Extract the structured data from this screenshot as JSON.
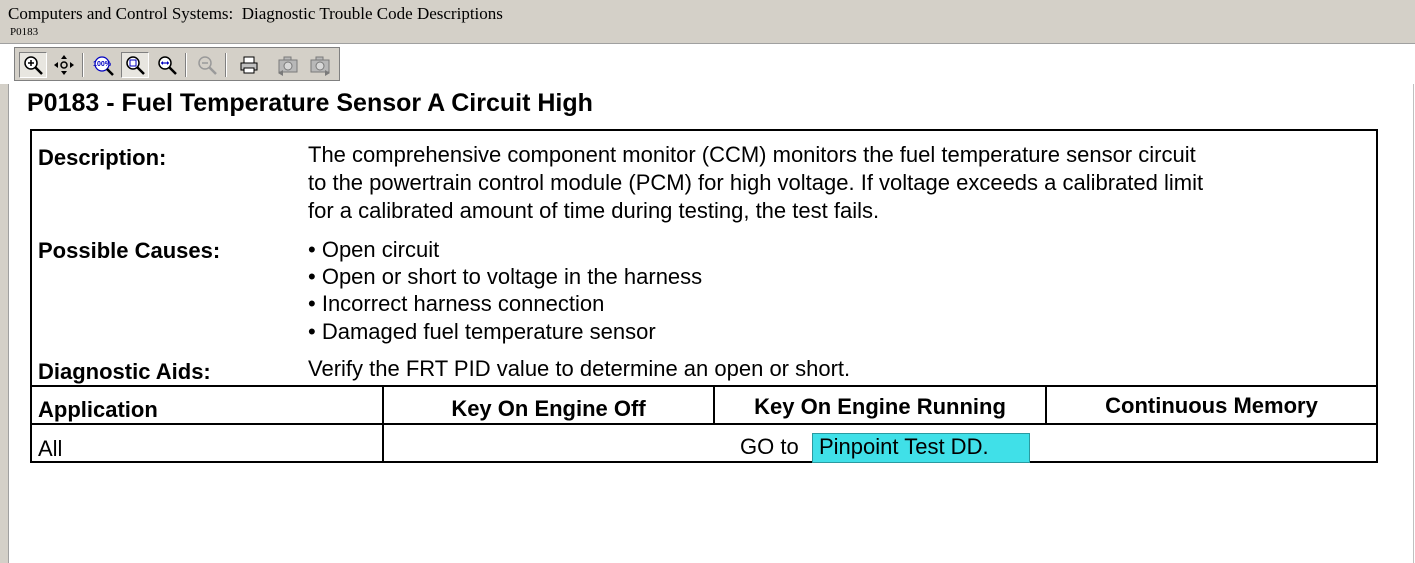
{
  "window": {
    "title": "Computers and Control Systems:  Diagnostic Trouble Code Descriptions",
    "subtitle": "P0183"
  },
  "toolbar": {
    "buttons": [
      {
        "icon": "zoom-in-icon"
      },
      {
        "icon": "pan-icon"
      },
      {
        "icon": "zoom-100-icon",
        "label": "100%"
      },
      {
        "icon": "zoom-fit-icon"
      },
      {
        "icon": "zoom-width-icon"
      },
      {
        "icon": "zoom-out-icon"
      },
      {
        "icon": "print-icon"
      },
      {
        "icon": "camera-back-icon"
      },
      {
        "icon": "camera-forward-icon"
      }
    ]
  },
  "doc": {
    "heading": "P0183 - Fuel Temperature Sensor A Circuit High",
    "description_label": "Description:",
    "description_lines": [
      "The comprehensive component monitor (CCM) monitors the fuel temperature sensor circuit",
      "to the powertrain control module (PCM) for high voltage. If voltage exceeds a calibrated limit",
      "for a calibrated amount of time during testing, the test fails."
    ],
    "causes_label": "Possible Causes:",
    "causes": [
      "Open circuit",
      "Open or short to voltage in the harness",
      "Incorrect harness connection",
      "Damaged fuel temperature sensor"
    ],
    "aids_label": "Diagnostic Aids:",
    "aids_text": "Verify the FRT PID value to determine an open or short.",
    "table": {
      "headers": [
        "Application",
        "Key On Engine Off",
        "Key On Engine Running",
        "Continuous Memory"
      ],
      "row": {
        "application": "All",
        "go_to": "GO to",
        "link": "Pinpoint Test DD."
      }
    }
  },
  "colors": {
    "chrome": "#d4d0c8",
    "link_highlight": "#40e0e8"
  }
}
